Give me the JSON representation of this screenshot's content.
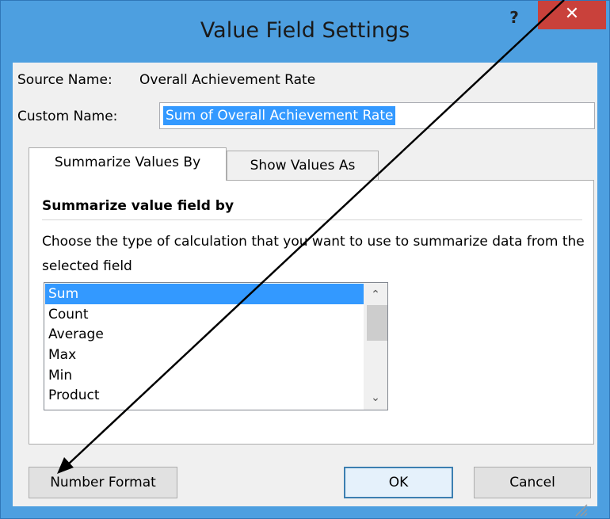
{
  "dialog": {
    "title": "Value Field Settings",
    "help_label": "?",
    "close_label": "✕"
  },
  "source": {
    "label": "Source Name:",
    "value": "Overall Achievement Rate"
  },
  "custom_name": {
    "label": "Custom Name:",
    "value": "Sum of Overall Achievement Rate"
  },
  "tabs": [
    {
      "label": "Summarize Values By",
      "active": true
    },
    {
      "label": "Show Values As",
      "active": false
    }
  ],
  "panel": {
    "section_title": "Summarize value field by",
    "description": "Choose the type of calculation that you want to use to summarize data from the selected field",
    "list_items": [
      "Sum",
      "Count",
      "Average",
      "Max",
      "Min",
      "Product"
    ],
    "selected_item": "Sum"
  },
  "buttons": {
    "number_format": "Number Format",
    "ok": "OK",
    "cancel": "Cancel"
  },
  "colors": {
    "title_bar": "#4d9fe0",
    "close_button": "#c9413b",
    "selection": "#3399ff"
  }
}
